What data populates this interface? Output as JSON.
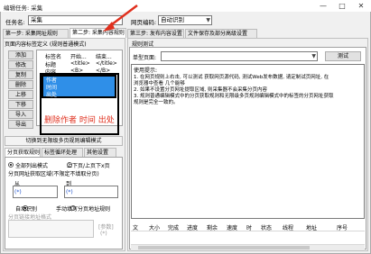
{
  "window": {
    "title": "编辑任务: 采集",
    "min": "—",
    "max": "□",
    "close": "✕"
  },
  "top": {
    "task_name_label": "任务名:",
    "task_name_value": "采集",
    "encoding_label": "网页编码:",
    "encoding_value": "自动识别"
  },
  "steps": {
    "step1": "第一步: 采集网址规则",
    "step2": "第二步: 采集内容规则",
    "step3": "第三步: 发布内容设置",
    "step4": "文件保存及部分高级设置"
  },
  "left": {
    "tag_header": "页面内容标签定义 (规则普通模式)",
    "buttons": [
      "添加",
      "修改",
      "复制",
      "删除",
      "上移",
      "下移",
      "导入",
      "导出"
    ],
    "table_headers": [
      "标签名",
      "开始...",
      "结束..."
    ],
    "rows": [
      [
        "标题",
        "<title>",
        "</title>"
      ],
      [
        "内容",
        "<B>",
        "</B>"
      ],
      [
        "作者",
        "",
        ""
      ],
      [
        "时间",
        "",
        ""
      ],
      [
        "出处",
        "",
        ""
      ]
    ],
    "annotation": "删除作者 时间 出处",
    "switch_button": "切换到无限级多页规则编辑模式",
    "subtabs": [
      "分页获取规则",
      "标签循环处理",
      "其他设置"
    ],
    "radio_all": "全部列出模式",
    "radio_next": "上下页/上页下x页",
    "page_rule_label": "分页网址获取区域(不限定不填取分页)",
    "from_label": "从",
    "to_label": "到",
    "link_marker": "(*)",
    "radio_auto": "自动识别",
    "radio_manual": "手动填写分页地址规则",
    "page_addr_format_label": "分页链接地址格式",
    "param_label": "[参数]",
    "param_marker": "(*)"
  },
  "right": {
    "rule_test_header": "规则测试",
    "single_page_label": "单型页面:",
    "test_button": "测试",
    "tips_title": "使用提示:",
    "tips": [
      "1. 在网页规则上右击, 可以测试 获取网页源代码, 测试Web发布数据, 请定制试页网址, 在",
      "浏览器中查看 几个能够",
      "2. 如果不设置分页网址提取区域, 则采集器不会采集分页内容",
      "3. 规则普通编辑模式中的分页获取规则和无限级多页规则编辑模式中的标签的分页网址获取",
      "规则是完全一致的。"
    ],
    "bottom_tabs": [
      "文",
      "大小",
      "完成",
      "进度",
      "剩余",
      "速度",
      "时",
      "状态",
      "线程",
      "地址",
      "序号"
    ]
  },
  "colors": {
    "selection": "#2f8fe8",
    "annotation": "#e0301e",
    "arrow": "#e0301e"
  }
}
